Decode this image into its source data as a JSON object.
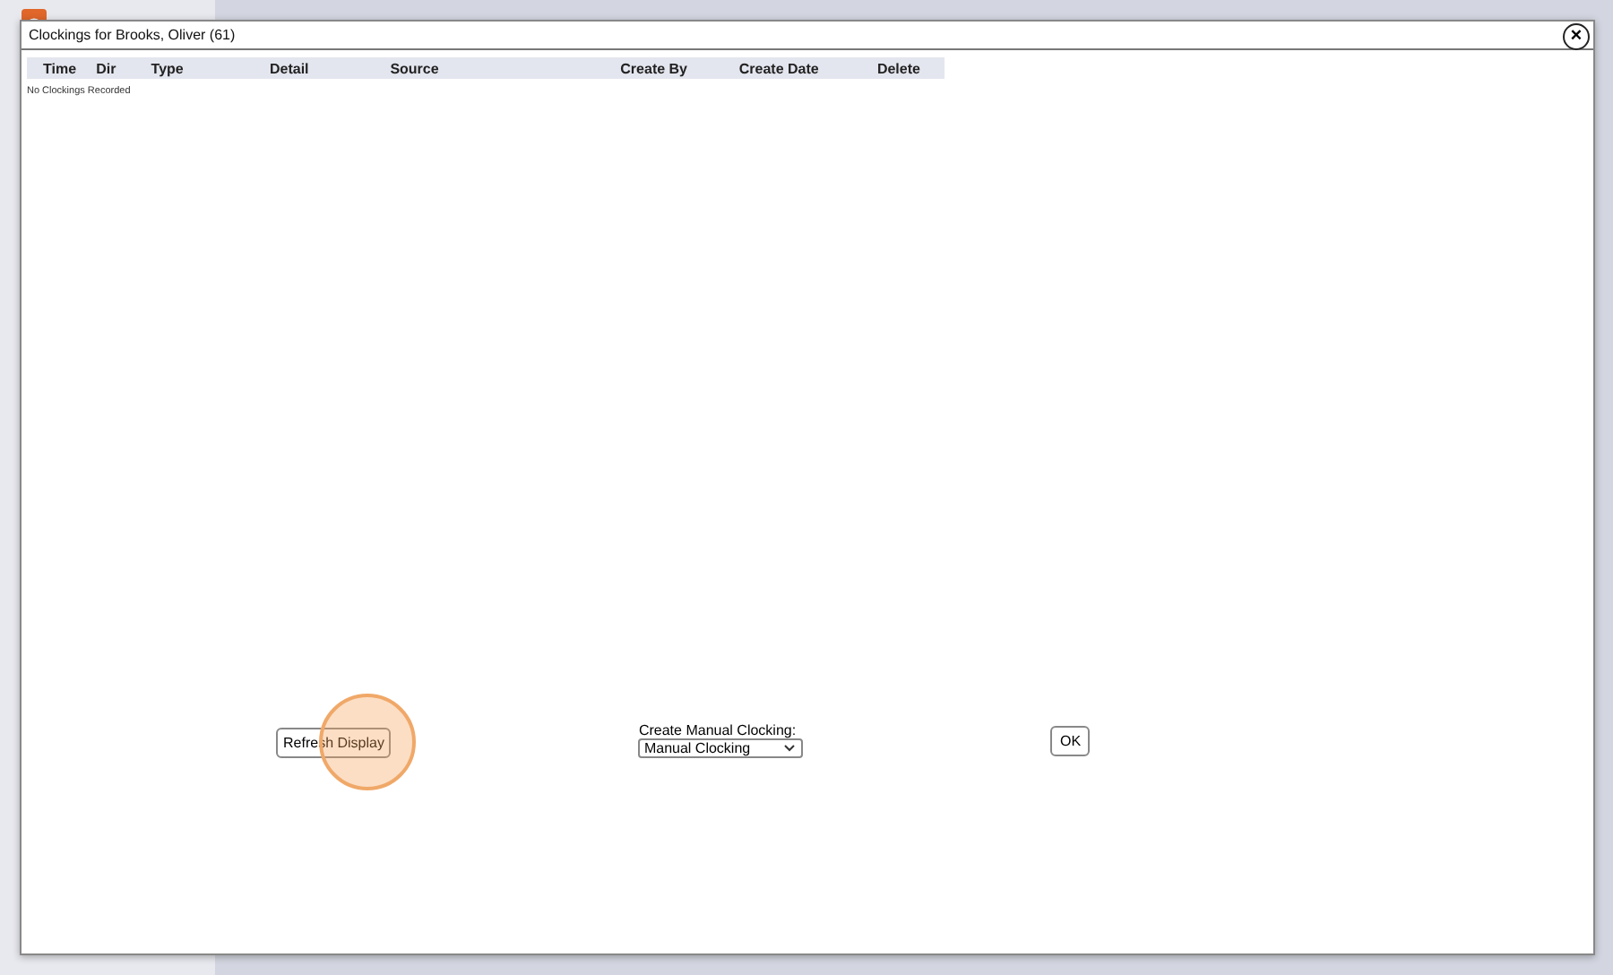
{
  "dialog": {
    "title": "Clockings for Brooks, Oliver (61)",
    "close": "×",
    "table": {
      "columns": [
        "Time",
        "Dir",
        "Type",
        "Detail",
        "Source",
        "Create By",
        "Create Date",
        "Delete"
      ],
      "empty_message": "No Clockings Recorded"
    },
    "refresh_button": "Refresh Display",
    "click_highlight": true,
    "manual_clocking": {
      "label": "Create Manual Clocking:",
      "value": "Manual Clocking"
    },
    "ok_button": "OK"
  }
}
